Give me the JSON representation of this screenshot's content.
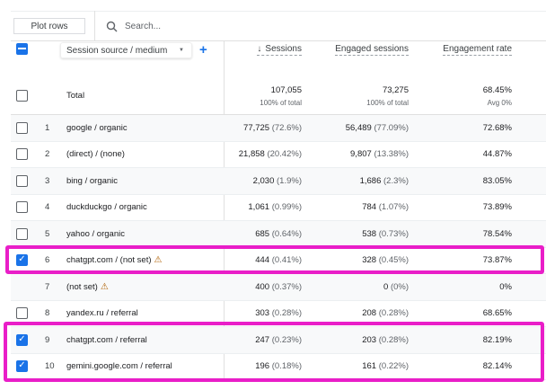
{
  "toolbar": {
    "plot_rows": "Plot rows",
    "search_placeholder": "Search..."
  },
  "header": {
    "dimension": "Session source / medium",
    "columns": [
      "Sessions",
      "Engaged sessions",
      "Engagement rate"
    ]
  },
  "total": {
    "label": "Total",
    "sessions": "107,055",
    "sessions_sub": "100% of total",
    "engaged": "73,275",
    "engaged_sub": "100% of total",
    "rate": "68.45%",
    "rate_sub": "Avg 0%"
  },
  "rows": [
    {
      "idx": "1",
      "name": "google / organic",
      "s": "77,725",
      "sp": "(72.6%)",
      "e": "56,489",
      "ep": "(77.09%)",
      "r": "72.68%",
      "checked": false,
      "warn": false
    },
    {
      "idx": "2",
      "name": "(direct) / (none)",
      "s": "21,858",
      "sp": "(20.42%)",
      "e": "9,807",
      "ep": "(13.38%)",
      "r": "44.87%",
      "checked": false,
      "warn": false
    },
    {
      "idx": "3",
      "name": "bing / organic",
      "s": "2,030",
      "sp": "(1.9%)",
      "e": "1,686",
      "ep": "(2.3%)",
      "r": "83.05%",
      "checked": false,
      "warn": false
    },
    {
      "idx": "4",
      "name": "duckduckgo / organic",
      "s": "1,061",
      "sp": "(0.99%)",
      "e": "784",
      "ep": "(1.07%)",
      "r": "73.89%",
      "checked": false,
      "warn": false
    },
    {
      "idx": "5",
      "name": "yahoo / organic",
      "s": "685",
      "sp": "(0.64%)",
      "e": "538",
      "ep": "(0.73%)",
      "r": "78.54%",
      "checked": false,
      "warn": false
    },
    {
      "idx": "6",
      "name": "chatgpt.com / (not set)",
      "s": "444",
      "sp": "(0.41%)",
      "e": "328",
      "ep": "(0.45%)",
      "r": "73.87%",
      "checked": true,
      "warn": true
    },
    {
      "idx": "7",
      "name": "(not set)",
      "s": "400",
      "sp": "(0.37%)",
      "e": "0",
      "ep": "(0%)",
      "r": "0%",
      "checked": null,
      "warn": true
    },
    {
      "idx": "8",
      "name": "yandex.ru / referral",
      "s": "303",
      "sp": "(0.28%)",
      "e": "208",
      "ep": "(0.28%)",
      "r": "68.65%",
      "checked": false,
      "warn": false
    },
    {
      "idx": "9",
      "name": "chatgpt.com / referral",
      "s": "247",
      "sp": "(0.23%)",
      "e": "203",
      "ep": "(0.28%)",
      "r": "82.19%",
      "checked": true,
      "warn": false
    },
    {
      "idx": "10",
      "name": "gemini.google.com / referral",
      "s": "196",
      "sp": "(0.18%)",
      "e": "161",
      "ep": "(0.22%)",
      "r": "82.14%",
      "checked": true,
      "warn": false
    }
  ],
  "highlight_color": "#e91ec8"
}
